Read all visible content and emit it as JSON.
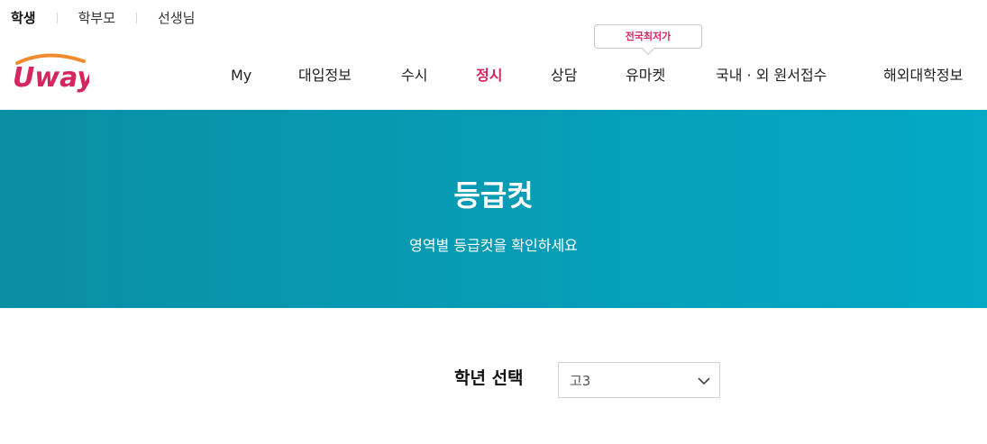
{
  "user_tabs": [
    {
      "label": "학생",
      "active": true
    },
    {
      "label": "학부모",
      "active": false
    },
    {
      "label": "선생님",
      "active": false
    }
  ],
  "logo": {
    "text": "Uway",
    "color": "#d6265f",
    "accent": "#f28a2e"
  },
  "nav": {
    "badge": "전국최저가",
    "items": [
      {
        "label": "My"
      },
      {
        "label": "대입정보"
      },
      {
        "label": "수시"
      },
      {
        "label": "정시",
        "active": true
      },
      {
        "label": "상담"
      },
      {
        "label": "유마켓"
      },
      {
        "label": "국내 · 외 원서접수"
      },
      {
        "label": "해외대학정보"
      }
    ]
  },
  "hero": {
    "title": "등급컷",
    "subtitle": "영역별 등급컷을 확인하세요",
    "gradient_start": "#0a8fa3",
    "gradient_end": "#04a9c6"
  },
  "grade": {
    "label": "학년 선택",
    "selected": "고3",
    "icon": "chevron-down-icon"
  }
}
